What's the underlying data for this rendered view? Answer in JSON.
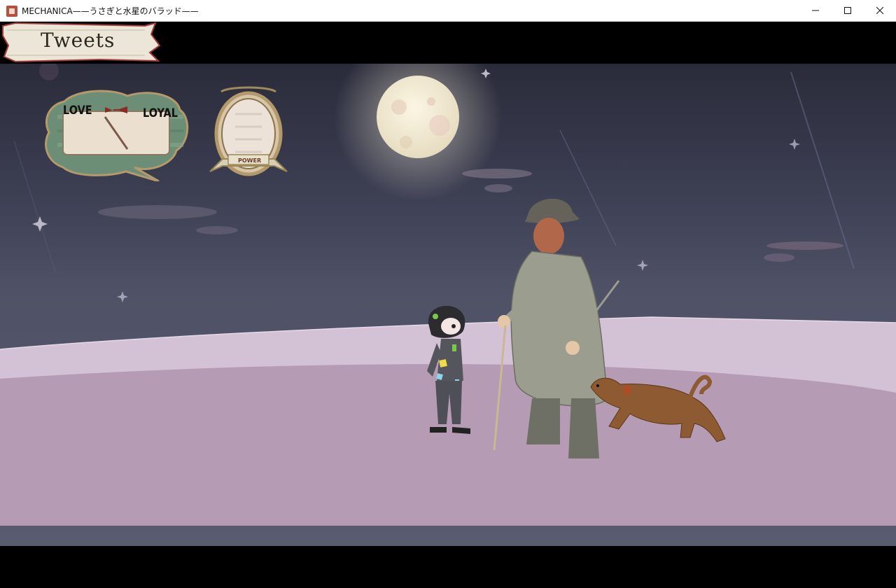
{
  "window": {
    "title": "MECHANICA——うさぎと水星のバラッド——",
    "controls": [
      "minimize",
      "maximize",
      "close"
    ]
  },
  "hud": {
    "tweets_label": "Tweets",
    "meter": {
      "left_label": "LOVE",
      "right_label": "LOYAL"
    },
    "power_label": "POWER"
  },
  "scene": {
    "characters": [
      "girl-character",
      "old-man-character",
      "dog-character"
    ],
    "colors": {
      "sky": "#3c3e52",
      "ground": "#b59cb4",
      "horizon": "#d3c2d6",
      "moon": "#f2ecd8"
    }
  }
}
